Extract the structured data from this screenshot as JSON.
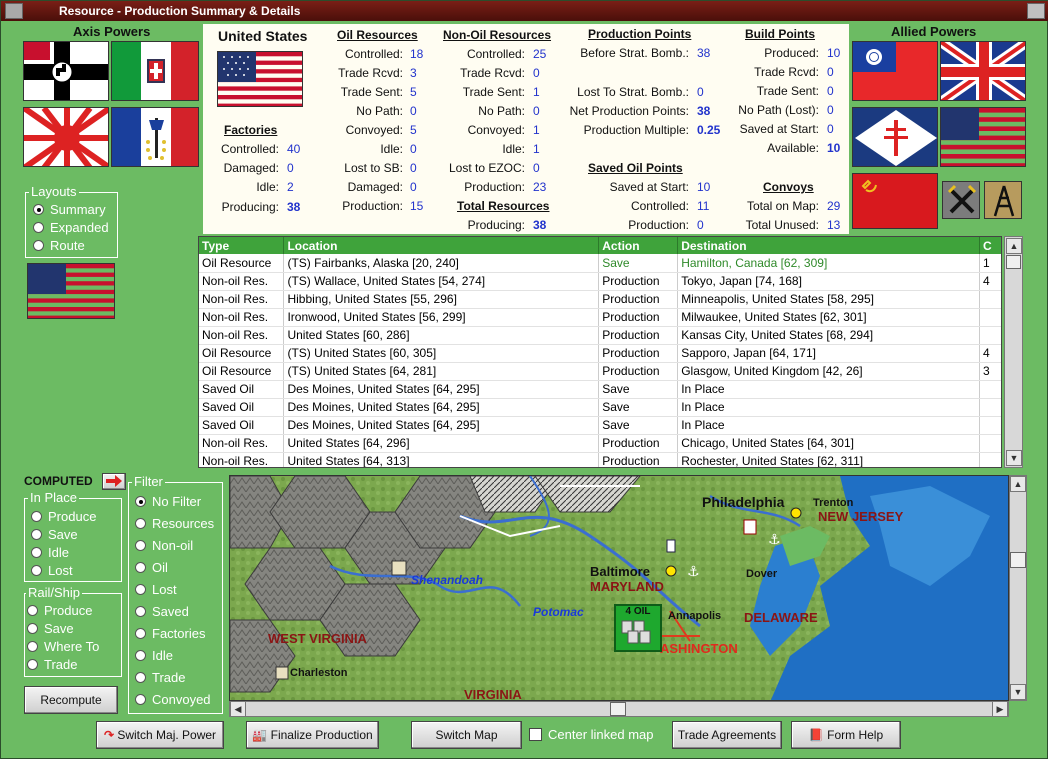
{
  "window": {
    "title": "Resource - Production Summary & Details"
  },
  "axis": {
    "header": "Axis Powers"
  },
  "allied": {
    "header": "Allied Powers"
  },
  "info": {
    "country": "United States",
    "factories": {
      "title": "Factories",
      "rows": [
        {
          "label": "Controlled:",
          "value": "40"
        },
        {
          "label": "Damaged:",
          "value": "0"
        },
        {
          "label": "Idle:",
          "value": "2"
        },
        {
          "label": "Producing:",
          "value": "38"
        }
      ]
    },
    "oil": {
      "title": "Oil Resources",
      "rows": [
        {
          "label": "Controlled:",
          "value": "18"
        },
        {
          "label": "Trade Rcvd:",
          "value": "3"
        },
        {
          "label": "Trade Sent:",
          "value": "5"
        },
        {
          "label": "No Path:",
          "value": "0"
        },
        {
          "label": "Convoyed:",
          "value": "5"
        },
        {
          "label": "Idle:",
          "value": "0"
        },
        {
          "label": "Lost to SB:",
          "value": "0"
        },
        {
          "label": "Damaged:",
          "value": "0"
        },
        {
          "label": "Production:",
          "value": "15"
        }
      ]
    },
    "nonoil": {
      "title": "Non-Oil Resources",
      "rows": [
        {
          "label": "Controlled:",
          "value": "25"
        },
        {
          "label": "Trade Rcvd:",
          "value": "0"
        },
        {
          "label": "Trade Sent:",
          "value": "1"
        },
        {
          "label": "No Path:",
          "value": "0"
        },
        {
          "label": "Convoyed:",
          "value": "1"
        },
        {
          "label": "Idle:",
          "value": "1"
        },
        {
          "label": "Lost to EZOC:",
          "value": "0"
        },
        {
          "label": "Production:",
          "value": "23"
        }
      ]
    },
    "total": {
      "title": "Total Resources",
      "label": "Producing:",
      "value": "38"
    },
    "pp": {
      "title": "Production Points",
      "before_label": "Before Strat. Bomb.:",
      "before_value": "38",
      "lost_label": "Lost To Strat. Bomb.:",
      "lost_value": "0",
      "net_label": "Net Production Points:",
      "net_value": "38",
      "mult_label": "Production Multiple:",
      "mult_value": "0.25"
    },
    "saved_oil": {
      "title": "Saved Oil Points",
      "rows": [
        {
          "label": "Saved at Start:",
          "value": "10"
        },
        {
          "label": "Controlled:",
          "value": "11"
        },
        {
          "label": "Production:",
          "value": "0"
        }
      ]
    },
    "build": {
      "title": "Build Points",
      "rows": [
        {
          "label": "Produced:",
          "value": "10"
        },
        {
          "label": "Trade Rcvd:",
          "value": "0"
        },
        {
          "label": "Trade Sent:",
          "value": "0"
        },
        {
          "label": "No Path (Lost):",
          "value": "0"
        },
        {
          "label": "Saved at Start:",
          "value": "0"
        },
        {
          "label": "Available:",
          "value": "10"
        }
      ]
    },
    "convoys": {
      "title": "Convoys",
      "rows": [
        {
          "label": "Total on Map:",
          "value": "29"
        },
        {
          "label": "Total Unused:",
          "value": "13"
        }
      ]
    }
  },
  "layouts": {
    "title": "Layouts",
    "options": [
      {
        "label": "Summary",
        "selected": true
      },
      {
        "label": "Expanded",
        "selected": false
      },
      {
        "label": "Route",
        "selected": false
      }
    ]
  },
  "table": {
    "headers": [
      "Type",
      "Location",
      "Action",
      "Destination",
      "C"
    ],
    "rows": [
      {
        "type": "Oil Resource",
        "location": "(TS) Fairbanks, Alaska [20, 240]",
        "action": "Save",
        "destination": "Hamilton, Canada [62, 309]",
        "c": "1",
        "green": true
      },
      {
        "type": "Non-oil Res.",
        "location": "(TS) Wallace, United States [54, 274]",
        "action": "Production",
        "destination": "Tokyo, Japan [74, 168]",
        "c": "4"
      },
      {
        "type": "Non-oil Res.",
        "location": "Hibbing, United States [55, 296]",
        "action": "Production",
        "destination": "Minneapolis, United States [58, 295]",
        "c": ""
      },
      {
        "type": "Non-oil Res.",
        "location": "Ironwood, United States [56, 299]",
        "action": "Production",
        "destination": "Milwaukee, United States [62, 301]",
        "c": ""
      },
      {
        "type": "Non-oil Res.",
        "location": "United States [60, 286]",
        "action": "Production",
        "destination": "Kansas City, United States [68, 294]",
        "c": ""
      },
      {
        "type": "Oil Resource",
        "location": "(TS) United States [60, 305]",
        "action": "Production",
        "destination": "Sapporo, Japan [64, 171]",
        "c": "4"
      },
      {
        "type": "Oil Resource",
        "location": "(TS) United States [64, 281]",
        "action": "Production",
        "destination": "Glasgow, United Kingdom [42, 26]",
        "c": "3"
      },
      {
        "type": "Saved Oil",
        "location": "Des Moines, United States [64, 295]",
        "action": "Save",
        "destination": "In Place",
        "c": ""
      },
      {
        "type": "Saved Oil",
        "location": "Des Moines, United States [64, 295]",
        "action": "Save",
        "destination": "In Place",
        "c": ""
      },
      {
        "type": "Saved Oil",
        "location": "Des Moines, United States [64, 295]",
        "action": "Save",
        "destination": "In Place",
        "c": ""
      },
      {
        "type": "Non-oil Res.",
        "location": "United States [64, 296]",
        "action": "Production",
        "destination": "Chicago, United States [64, 301]",
        "c": ""
      },
      {
        "type": "Non-oil Res.",
        "location": "United States [64, 313]",
        "action": "Production",
        "destination": "Rochester, United States [62, 311]",
        "c": ""
      }
    ]
  },
  "computed": {
    "label": "COMPUTED"
  },
  "in_place": {
    "title": "In Place",
    "options": [
      "Produce",
      "Save",
      "Idle",
      "Lost"
    ]
  },
  "rail_ship": {
    "title": "Rail/Ship",
    "options": [
      "Produce",
      "Save",
      "Where To",
      "Trade"
    ]
  },
  "filter": {
    "title": "Filter",
    "options": [
      "No Filter",
      "Resources",
      "Non-oil",
      "Oil",
      "Lost",
      "Saved",
      "Factories",
      "Idle",
      "Trade",
      "Convoyed"
    ],
    "selected": "No Filter"
  },
  "buttons": {
    "recompute": "Recompute",
    "switch_major": "Switch Maj. Power",
    "finalize": "Finalize Production",
    "switch_map": "Switch Map",
    "center_linked": "Center linked map",
    "trade_agreements": "Trade Agreements",
    "form_help": "Form Help"
  },
  "map": {
    "labels": {
      "philadelphia": "Philadelphia",
      "trenton": "Trenton",
      "new_jersey": "NEW JERSEY",
      "baltimore": "Baltimore",
      "maryland": "MARYLAND",
      "dover": "Dover",
      "shenandoah": "Shenandoah",
      "potomac": "Potomac",
      "annapolis": "Annapolis",
      "delaware": "DELAWARE",
      "washington": "ASHINGTON",
      "west_virginia": "WEST VIRGINIA",
      "charleston": "Charleston",
      "virginia": "VIRGINIA",
      "oil_counter": "4 OIL"
    }
  },
  "colors": {
    "panel_green": "#6cbb63",
    "table_header": "#3fa33b",
    "value_blue": "#2233cc",
    "title_red": "#7a1f16"
  }
}
